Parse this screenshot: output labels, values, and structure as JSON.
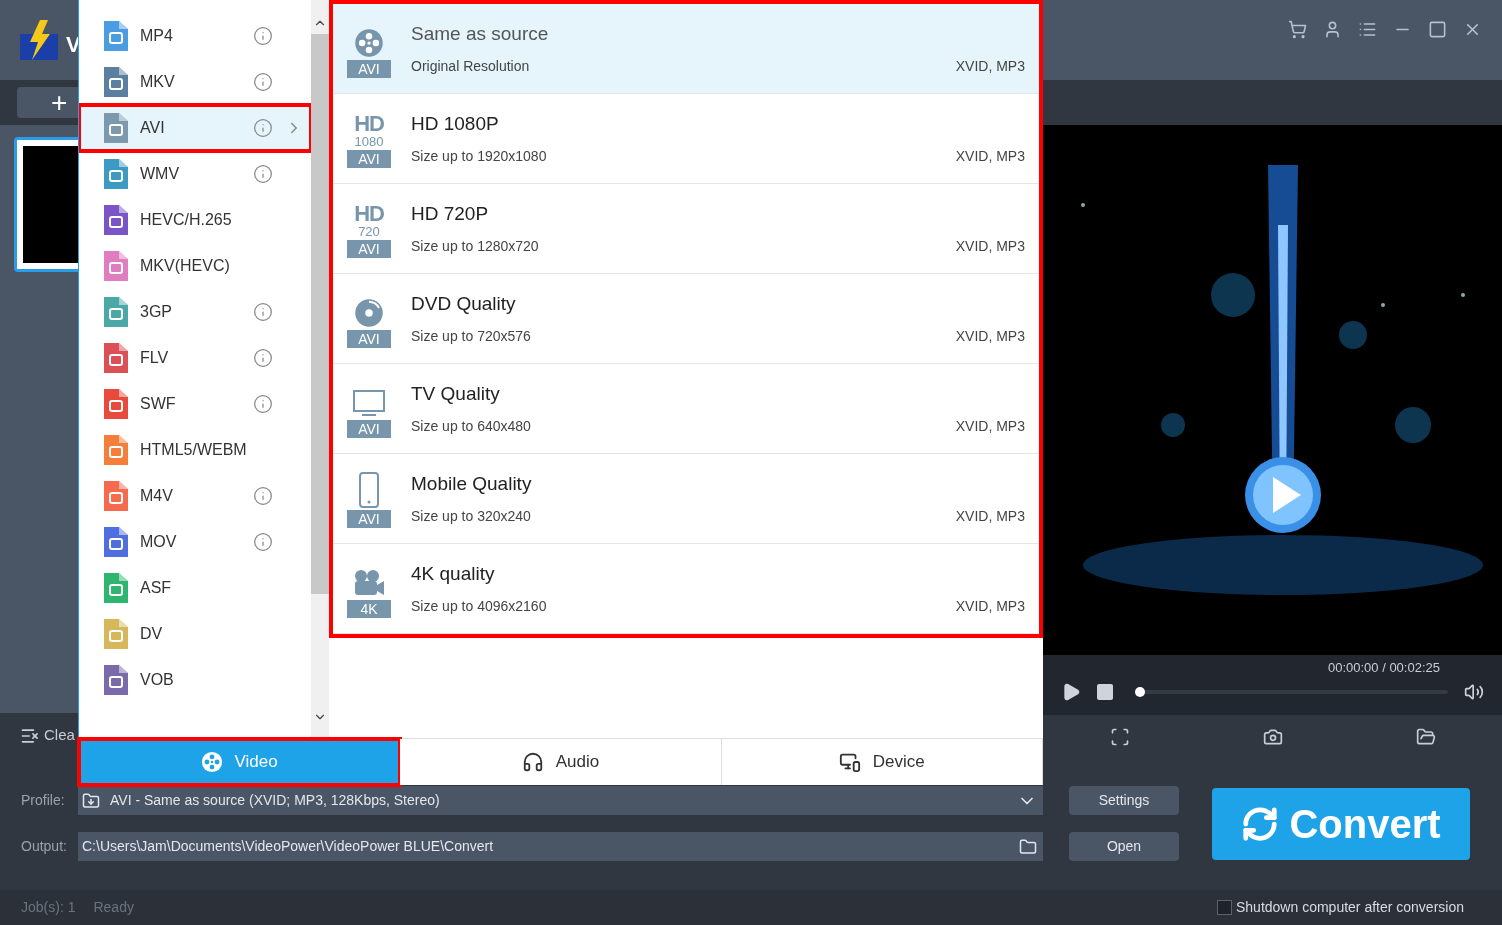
{
  "app": {
    "title_visible": "V"
  },
  "toolbar": {
    "add_label": "+"
  },
  "formats": [
    {
      "label": "MP4",
      "color": "#4a9de0",
      "has_info": true,
      "selected": false
    },
    {
      "label": "MKV",
      "color": "#5b7fa0",
      "has_info": true,
      "selected": false
    },
    {
      "label": "AVI",
      "color": "#7c99ad",
      "has_info": true,
      "selected": true
    },
    {
      "label": "WMV",
      "color": "#3d9ac2",
      "has_info": true,
      "selected": false
    },
    {
      "label": "HEVC/H.265",
      "color": "#7a55c8",
      "has_info": false,
      "selected": false
    },
    {
      "label": "MKV(HEVC)",
      "color": "#e07cc0",
      "has_info": false,
      "selected": false
    },
    {
      "label": "3GP",
      "color": "#4aa8a6",
      "has_info": true,
      "selected": false
    },
    {
      "label": "FLV",
      "color": "#db4f55",
      "has_info": true,
      "selected": false
    },
    {
      "label": "SWF",
      "color": "#e84a3c",
      "has_info": true,
      "selected": false
    },
    {
      "label": "HTML5/WEBM",
      "color": "#f57f3a",
      "has_info": false,
      "selected": false
    },
    {
      "label": "M4V",
      "color": "#f66a4e",
      "has_info": true,
      "selected": false
    },
    {
      "label": "MOV",
      "color": "#4f6ee0",
      "has_info": true,
      "selected": false
    },
    {
      "label": "ASF",
      "color": "#2fb66e",
      "has_info": false,
      "selected": false
    },
    {
      "label": "DV",
      "color": "#d6b85a",
      "has_info": false,
      "selected": false
    },
    {
      "label": "VOB",
      "color": "#7a6aaa",
      "has_info": false,
      "selected": false
    }
  ],
  "presets": [
    {
      "kind": "reel",
      "badge": "AVI",
      "title": "Same as source",
      "subtitle": "Original Resolution",
      "codecs": "XVID, MP3",
      "selected": true
    },
    {
      "kind": "hd",
      "icon_text": [
        "HD",
        "1080"
      ],
      "badge": "AVI",
      "title": "HD 1080P",
      "subtitle": "Size up to 1920x1080",
      "codecs": "XVID, MP3",
      "selected": false
    },
    {
      "kind": "hd",
      "icon_text": [
        "HD",
        "720"
      ],
      "badge": "AVI",
      "title": "HD 720P",
      "subtitle": "Size up to 1280x720",
      "codecs": "XVID, MP3",
      "selected": false
    },
    {
      "kind": "disc",
      "badge": "AVI",
      "title": "DVD Quality",
      "subtitle": "Size up to 720x576",
      "codecs": "XVID, MP3",
      "selected": false
    },
    {
      "kind": "tv",
      "badge": "AVI",
      "title": "TV Quality",
      "subtitle": "Size up to 640x480",
      "codecs": "XVID, MP3",
      "selected": false
    },
    {
      "kind": "mobile",
      "badge": "AVI",
      "title": "Mobile Quality",
      "subtitle": "Size up to 320x240",
      "codecs": "XVID, MP3",
      "selected": false
    },
    {
      "kind": "camera",
      "badge": "4K",
      "title": "4K quality",
      "subtitle": "Size up to 4096x2160",
      "codecs": "XVID, MP3",
      "selected": false
    }
  ],
  "category_tabs": [
    {
      "kind": "video",
      "label": "Video",
      "selected": true
    },
    {
      "kind": "audio",
      "label": "Audio",
      "selected": false
    },
    {
      "kind": "device",
      "label": "Device",
      "selected": false
    }
  ],
  "clear_label": "Clea",
  "player": {
    "time": "00:00:00 / 00:02:25",
    "level": 0
  },
  "profile": {
    "label": "Profile:",
    "value": "AVI - Same as source (XVID; MP3, 128Kbps, Stereo)"
  },
  "output": {
    "label": "Output:",
    "value": "C:\\Users\\Jam\\Documents\\VideoPower\\VideoPower BLUE\\Convert"
  },
  "buttons": {
    "settings": "Settings",
    "open": "Open",
    "convert": "Convert"
  },
  "status": {
    "jobs": "Job(s): 1",
    "state": "Ready"
  },
  "shutdown": {
    "label": "Shutdown computer after conversion",
    "checked": false
  }
}
